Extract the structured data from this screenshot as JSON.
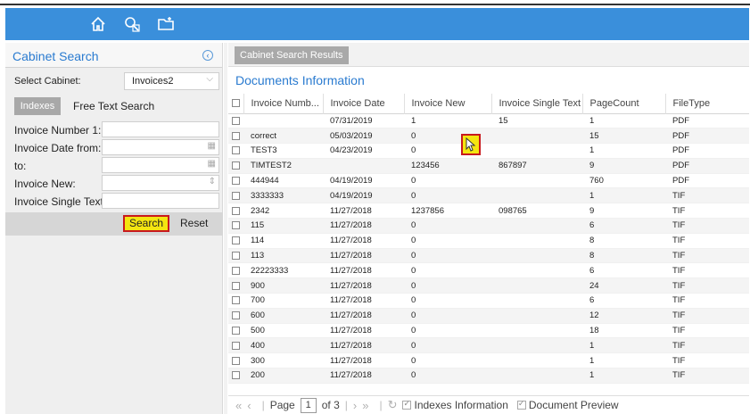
{
  "toolbar": {
    "icons": [
      "home-icon",
      "search-settings-icon",
      "folder-icon"
    ]
  },
  "cabinet_search": {
    "title": "Cabinet Search",
    "select_cabinet_label": "Select Cabinet:",
    "select_cabinet_value": "Invoices2",
    "tab_indexes": "Indexes",
    "tab_free_text": "Free Text Search",
    "fields": {
      "invoice_number_label": "Invoice Number 1:",
      "invoice_date_from_label": "Invoice Date from:",
      "to_label": "to:",
      "invoice_new_label": "Invoice New:",
      "invoice_single_text_label": "Invoice Single Text:"
    },
    "search_label": "Search",
    "reset_label": "Reset"
  },
  "results": {
    "tab_label": "Cabinet Search Results",
    "title": "Documents Information",
    "columns": [
      "Invoice Numb...",
      "Invoice Date",
      "Invoice New",
      "Invoice Single Text",
      "PageCount",
      "FileType"
    ],
    "rows": [
      [
        "",
        "07/31/2019",
        "1",
        "15",
        "1",
        "PDF"
      ],
      [
        "correct",
        "05/03/2019",
        "0",
        "",
        "15",
        "PDF"
      ],
      [
        "TEST3",
        "04/23/2019",
        "0",
        "",
        "1",
        "PDF"
      ],
      [
        "TIMTEST2",
        "",
        "123456",
        "867897",
        "9",
        "PDF"
      ],
      [
        "444944",
        "04/19/2019",
        "0",
        "",
        "760",
        "PDF"
      ],
      [
        "3333333",
        "04/19/2019",
        "0",
        "",
        "1",
        "TIF"
      ],
      [
        "2342",
        "11/27/2018",
        "1237856",
        "098765",
        "9",
        "TIF"
      ],
      [
        "115",
        "11/27/2018",
        "0",
        "",
        "6",
        "TIF"
      ],
      [
        "114",
        "11/27/2018",
        "0",
        "",
        "8",
        "TIF"
      ],
      [
        "113",
        "11/27/2018",
        "0",
        "",
        "8",
        "TIF"
      ],
      [
        "22223333",
        "11/27/2018",
        "0",
        "",
        "6",
        "TIF"
      ],
      [
        "900",
        "11/27/2018",
        "0",
        "",
        "24",
        "TIF"
      ],
      [
        "700",
        "11/27/2018",
        "0",
        "",
        "6",
        "TIF"
      ],
      [
        "600",
        "11/27/2018",
        "0",
        "",
        "12",
        "TIF"
      ],
      [
        "500",
        "11/27/2018",
        "0",
        "",
        "18",
        "TIF"
      ],
      [
        "400",
        "11/27/2018",
        "0",
        "",
        "1",
        "TIF"
      ],
      [
        "300",
        "11/27/2018",
        "0",
        "",
        "1",
        "TIF"
      ],
      [
        "200",
        "11/27/2018",
        "0",
        "",
        "1",
        "TIF"
      ]
    ],
    "pager": {
      "page_label": "Page",
      "page_value": "1",
      "of_label": "of 3",
      "indexes_info_label": "Indexes Information",
      "doc_preview_label": "Document Preview"
    }
  },
  "colors": {
    "accent": "#3a8fdb",
    "highlight": "#f4e511",
    "highlight_border": "#c8191e"
  }
}
